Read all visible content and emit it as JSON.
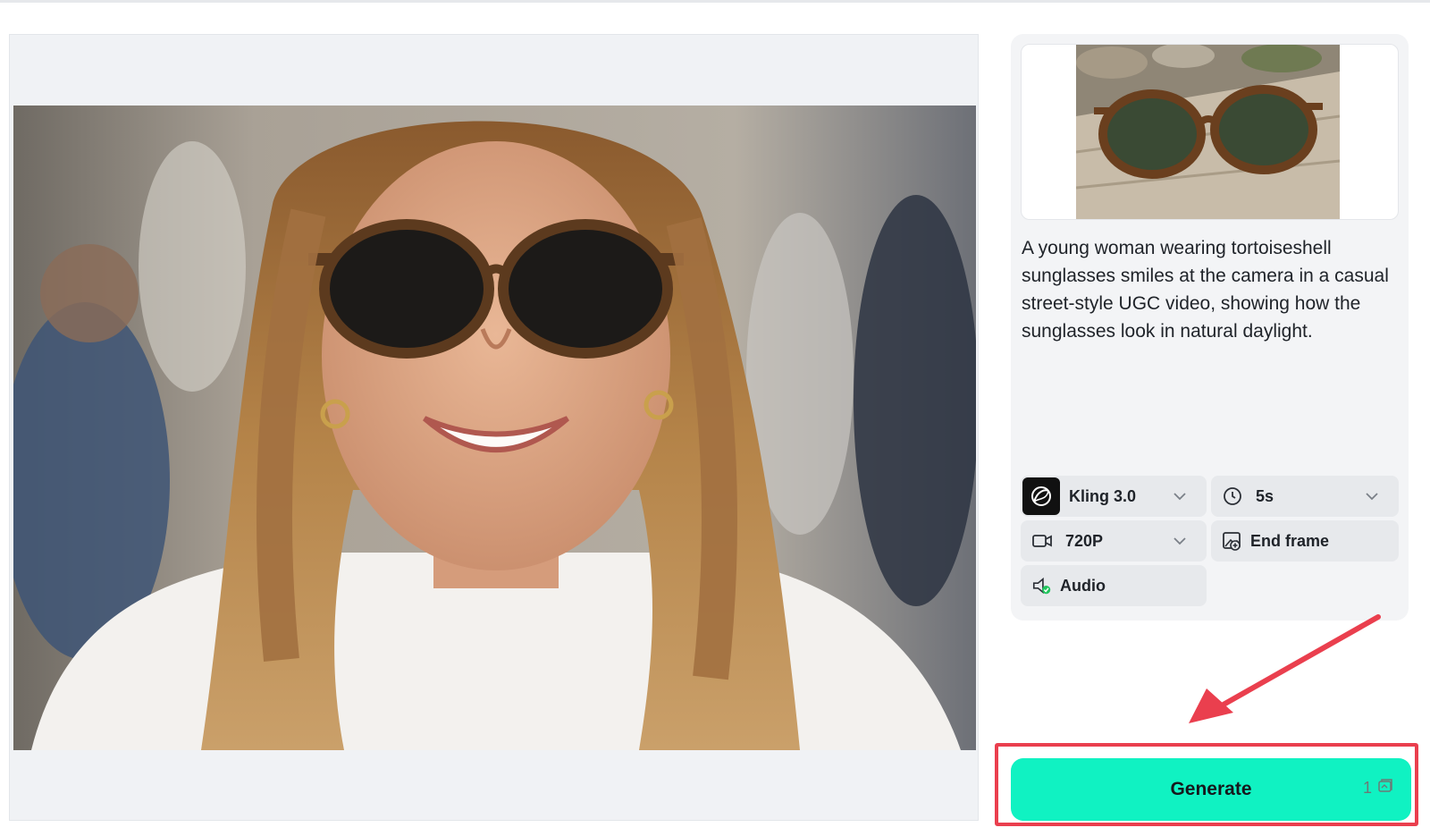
{
  "preview": {
    "image_alt": "A smiling woman with long wavy hair wearing tortoiseshell sunglasses on a sunny street"
  },
  "panel": {
    "reference_image_alt": "Tortoiseshell sunglasses on a wooden surface",
    "prompt_text": "A young woman wearing tortoiseshell sunglasses smiles at the camera in a casual street-style UGC video, showing how the sunglasses look in natural daylight.",
    "options": {
      "model": {
        "label": "Kling 3.0",
        "icon": "kling-logo-icon"
      },
      "duration": {
        "label": "5s",
        "icon": "clock-icon"
      },
      "resolution": {
        "label": "720P",
        "icon": "video-camera-icon"
      },
      "end_frame": {
        "label": "End frame",
        "icon": "image-add-icon"
      },
      "audio": {
        "label": "Audio",
        "icon": "audio-toggle-icon"
      }
    }
  },
  "generate": {
    "label": "Generate",
    "credits": "1",
    "credits_icon": "credit-icon",
    "accent_color": "#10f2c2"
  },
  "annotation": {
    "highlight_color": "#ea3f4e",
    "arrow_icon": "pointer-arrow-icon"
  }
}
